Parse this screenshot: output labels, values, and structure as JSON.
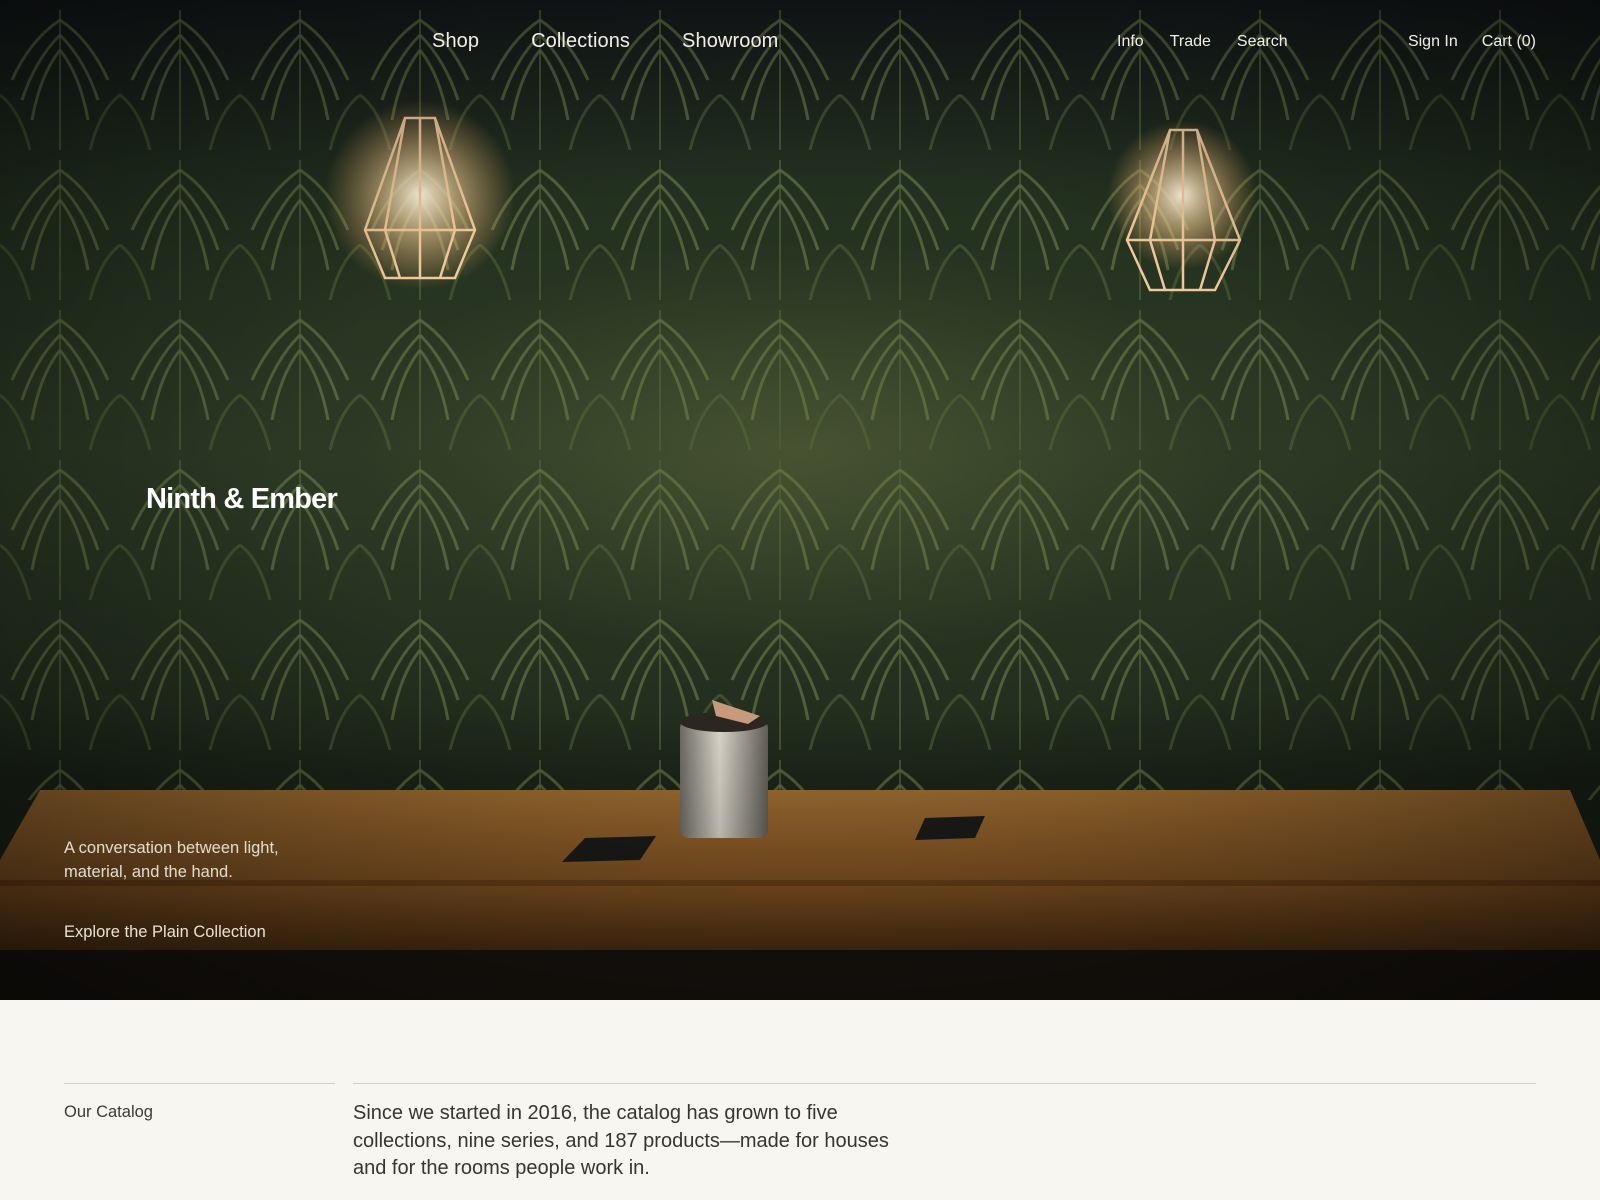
{
  "nav": {
    "main": [
      "Shop",
      "Collections",
      "Showroom"
    ],
    "secondary": [
      "Info",
      "Trade",
      "Search"
    ],
    "account": {
      "sign_in": "Sign In",
      "cart": "Cart (0)"
    }
  },
  "hero": {
    "brand": "Ninth & Ember",
    "tagline": "A conversation between light, material, and the hand.",
    "cta": "Explore the Plain Collection"
  },
  "catalog": {
    "label": "Our Catalog",
    "text": "Since we started in 2016, the catalog has grown to five collections, nine series, and 187 products—made for houses and for the rooms people work in."
  },
  "colors": {
    "page_background": "#f7f6f1",
    "hero_wall": "#2c3a25",
    "table_wood": "#8a5a24",
    "nav_text": "#f2efe6"
  }
}
